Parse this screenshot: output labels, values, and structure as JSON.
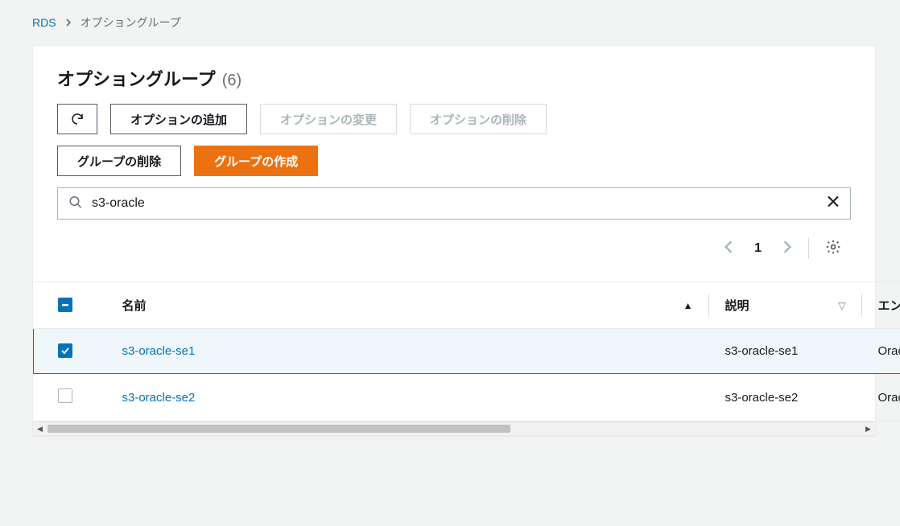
{
  "breadcrumb": {
    "root": "RDS",
    "current": "オプショングループ"
  },
  "header": {
    "title": "オプショングループ",
    "count": "(6)"
  },
  "toolbar": {
    "refresh": "",
    "add_option": "オプションの追加",
    "modify_option": "オプションの変更",
    "delete_option": "オプションの削除",
    "delete_group": "グループの削除",
    "create_group": "グループの作成"
  },
  "search": {
    "value": "s3-oracle"
  },
  "pagination": {
    "page": "1"
  },
  "columns": {
    "name": "名前",
    "description": "説明",
    "engine": "エンジン"
  },
  "rows": [
    {
      "selected": true,
      "name": "s3-oracle-se1",
      "description": "s3-oracle-se1",
      "engine": "Oracle Standar"
    },
    {
      "selected": false,
      "name": "s3-oracle-se2",
      "description": "s3-oracle-se2",
      "engine": "Oracle Standar"
    }
  ]
}
